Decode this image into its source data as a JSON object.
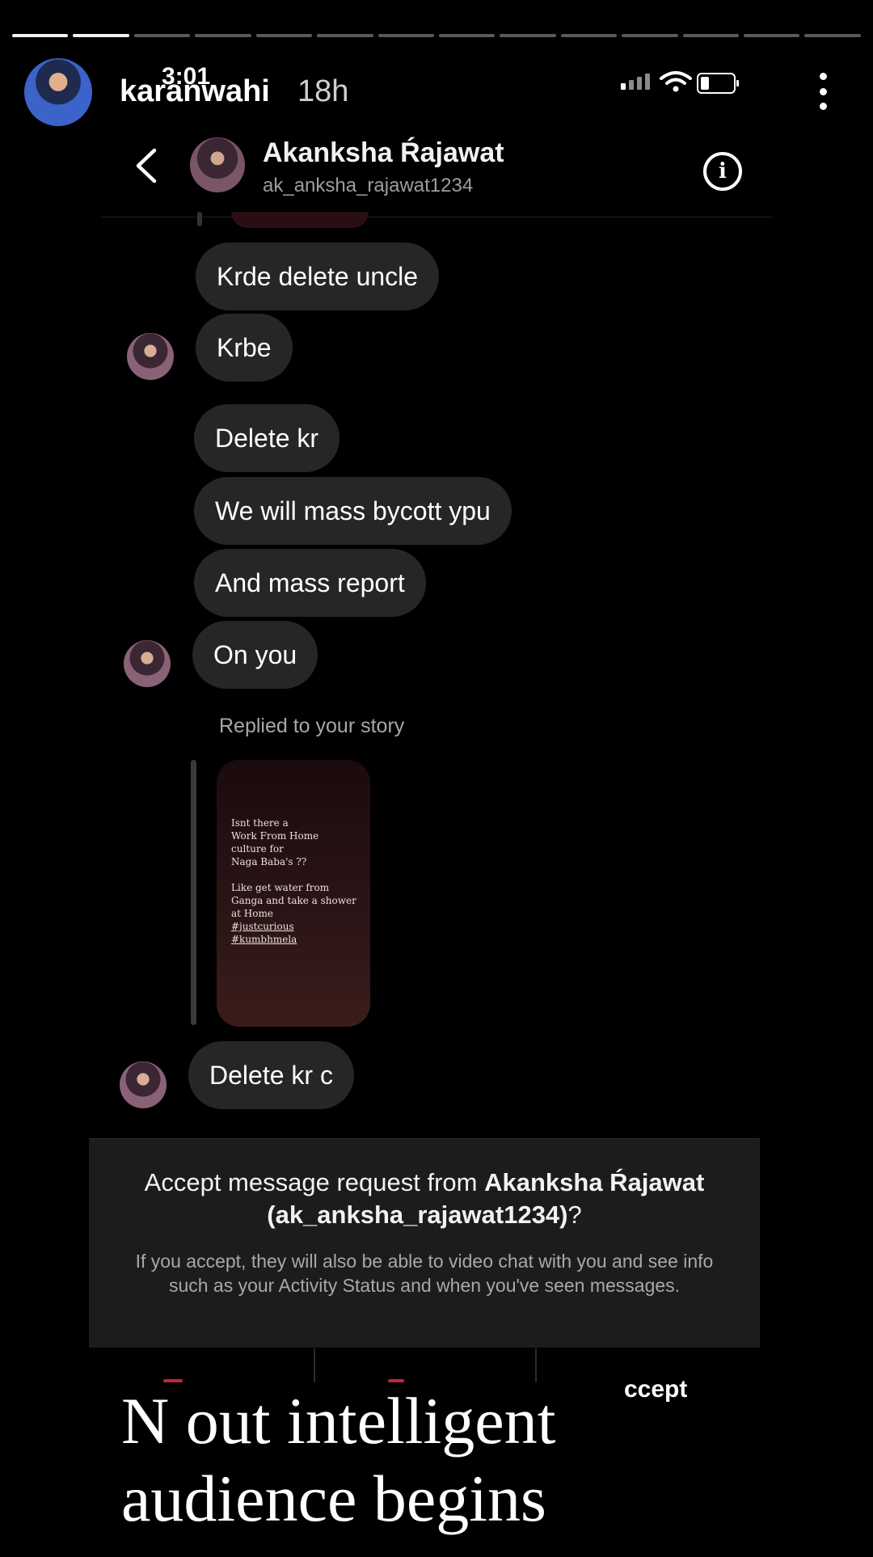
{
  "story": {
    "progress_segments_total": 14,
    "progress_segments_done": 2,
    "username": "karanwahi",
    "time_ago": "18h",
    "clock": "3:01",
    "icons": {
      "avatar": "profile-avatar",
      "signal": "cell-signal-icon",
      "wifi": "wifi-icon",
      "battery": "battery-icon",
      "more": "more-vertical-icon"
    }
  },
  "dm": {
    "contact_name": "Akanksha Ŕajawat",
    "contact_handle": "ak_anksha_rajawat1234",
    "icons": {
      "back": "back-chevron-icon",
      "info": "info-icon"
    },
    "messages": [
      "Krde delete uncle",
      "Krbe",
      "Delete kr",
      "We will mass bycott ypu",
      "And mass report",
      "On you",
      "Delete kr c"
    ],
    "replied_label": "Replied to your story",
    "story_card_lines": [
      "Isnt there a",
      "Work From Home",
      "culture for",
      "Naga Baba's ??",
      "Like get water from",
      "Ganga and take a shower",
      "at Home",
      "#justcurious",
      "#kumbhmela"
    ],
    "request": {
      "title_prefix": "Accept message request from",
      "title_name": "Akanksha Ŕajawat (ak_anksha_rajawat1234)",
      "title_suffix": "?",
      "body": "If you accept, they will also be able to video chat with you and see info such as your Activity Status and when you've seen messages."
    },
    "accept_label": "ccept"
  },
  "caption": {
    "line1": "N out intelligent",
    "line2": "audience begins"
  },
  "colors": {
    "background": "#000000",
    "bubble": "#262626",
    "request_panel": "#1c1c1c",
    "muted_text": "#a8a8a8"
  }
}
